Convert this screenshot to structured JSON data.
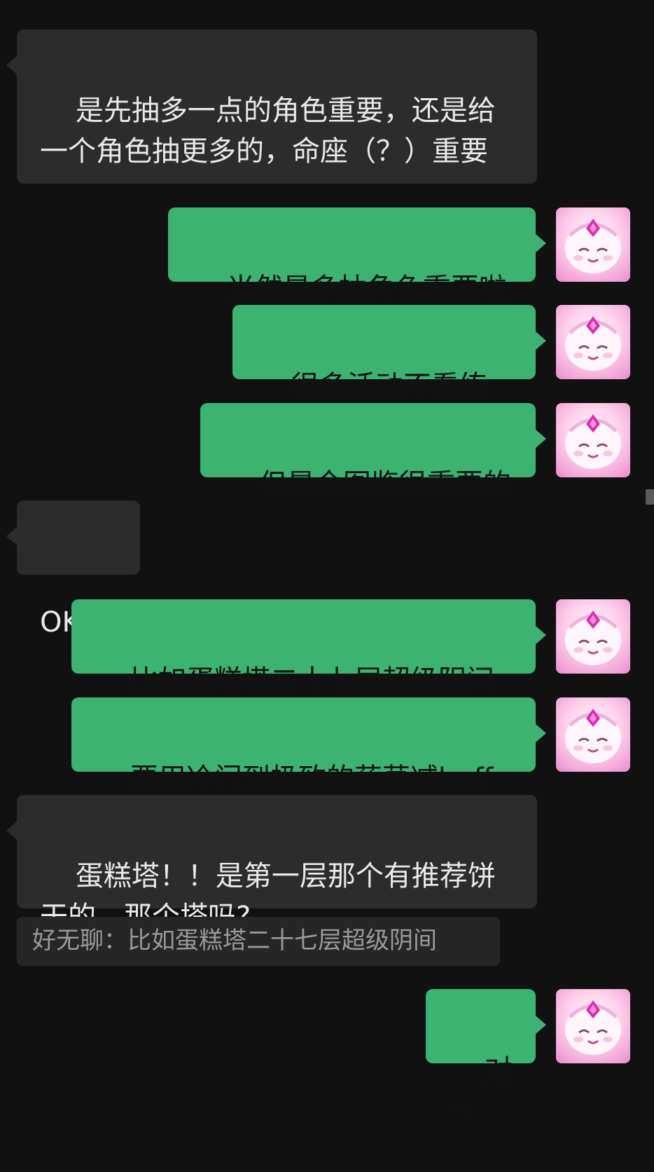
{
  "messages": [
    {
      "side": "in",
      "text": "是先抽多一点的角色重要，还是给一个角色抽更多的，命座（？）重要"
    },
    {
      "side": "out",
      "text": "当然是多抽角色重要啦"
    },
    {
      "side": "out",
      "text": "很多活动不看练度"
    },
    {
      "side": "out",
      "text": "但是全图鉴很重要的"
    },
    {
      "side": "in",
      "text": "OK!"
    },
    {
      "side": "out",
      "text": "比如蛋糕塔二十七层超级阴间"
    },
    {
      "side": "out",
      "text": "要用冷门到极致的药草减buff"
    },
    {
      "side": "in",
      "text": "蛋糕塔！！是第一层那个有推荐饼干的，那个塔吗?"
    },
    {
      "side": "out",
      "text": "对~"
    }
  ],
  "quote": {
    "text": "好无聊：比如蛋糕塔二十七层超级阴间"
  },
  "colors": {
    "background": "#111111",
    "incoming_bubble": "#2c2c2c",
    "outgoing_bubble": "#3cb371",
    "incoming_text": "#e9e9e9",
    "outgoing_text": "#121212",
    "quote_text": "#9a9a9a"
  },
  "avatar_icon": "pink-character-avatar"
}
